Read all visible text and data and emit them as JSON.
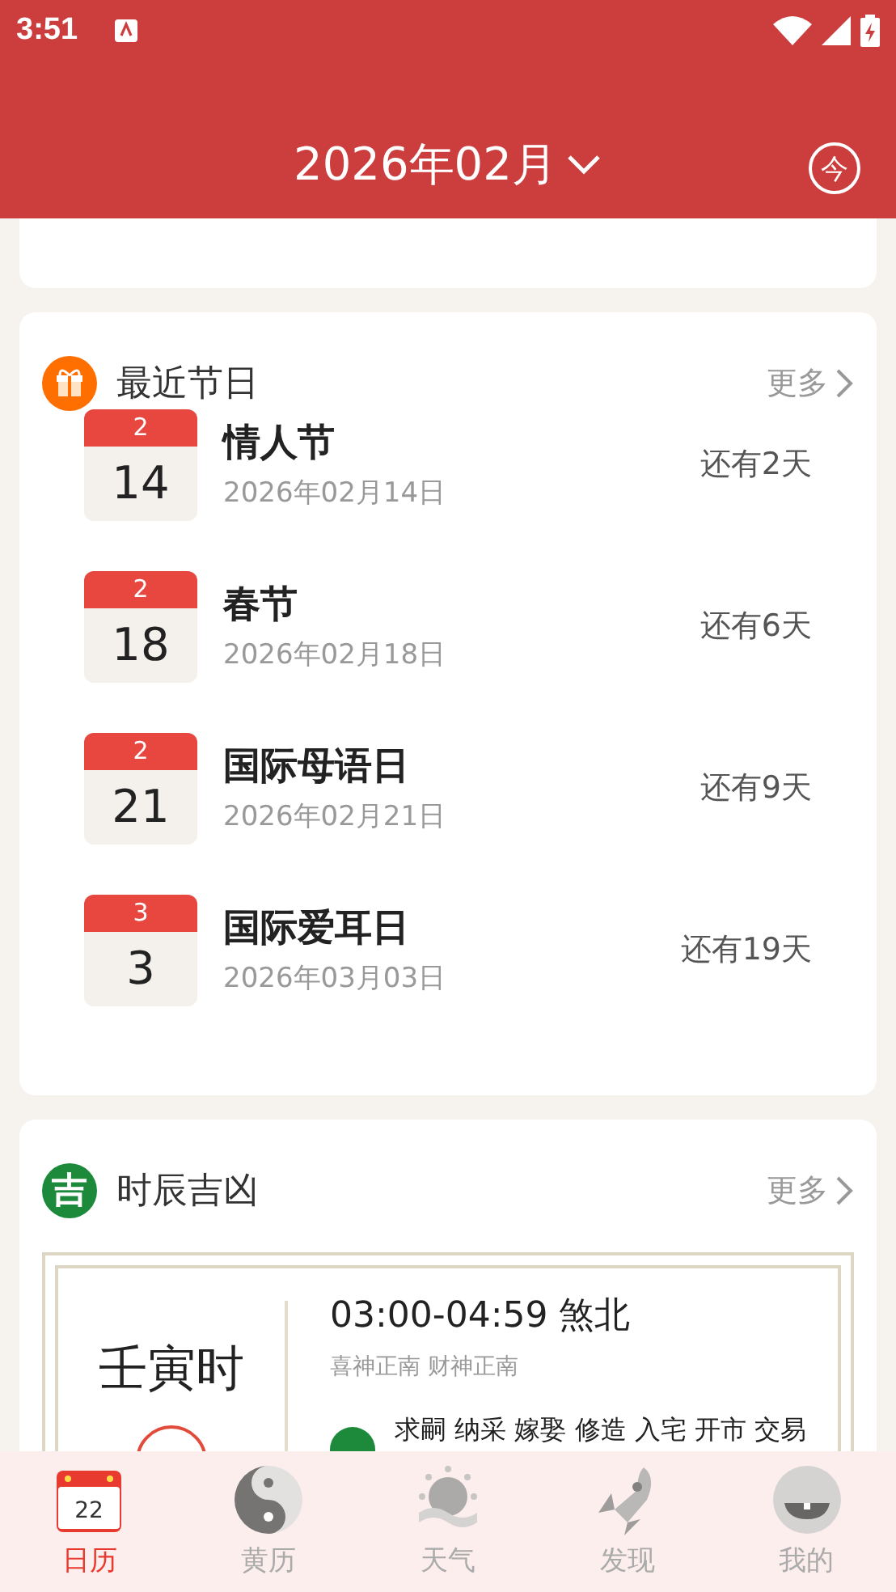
{
  "status_bar": {
    "time": "3:51"
  },
  "header": {
    "title": "2026年02月",
    "today_button": "今"
  },
  "festivals": {
    "title": "最近节日",
    "more": "更多",
    "items": [
      {
        "month": "2",
        "day": "14",
        "name": "情人节",
        "date": "2026年02月14日",
        "countdown": "还有2天"
      },
      {
        "month": "2",
        "day": "18",
        "name": "春节",
        "date": "2026年02月18日",
        "countdown": "还有6天"
      },
      {
        "month": "2",
        "day": "21",
        "name": "国际母语日",
        "date": "2026年02月21日",
        "countdown": "还有9天"
      },
      {
        "month": "3",
        "day": "3",
        "name": "国际爱耳日",
        "date": "2026年03月03日",
        "countdown": "还有19天"
      }
    ]
  },
  "shichen": {
    "title": "时辰吉凶",
    "badge": "吉",
    "more": "更多",
    "name": "壬寅时",
    "time": "03:00-04:59 煞北",
    "gods": "喜神正南 财神正南",
    "yi_items": "求嗣 纳采 嫁娶 修造 入宅 开市 交易"
  },
  "tabs": [
    {
      "label": "日历",
      "kind": "calendar",
      "icon_text": "22",
      "selected": true
    },
    {
      "label": "黄历",
      "kind": "yinyang",
      "selected": false
    },
    {
      "label": "天气",
      "kind": "weather",
      "selected": false
    },
    {
      "label": "发现",
      "kind": "rocket",
      "selected": false
    },
    {
      "label": "我的",
      "kind": "avatar",
      "selected": false
    }
  ]
}
